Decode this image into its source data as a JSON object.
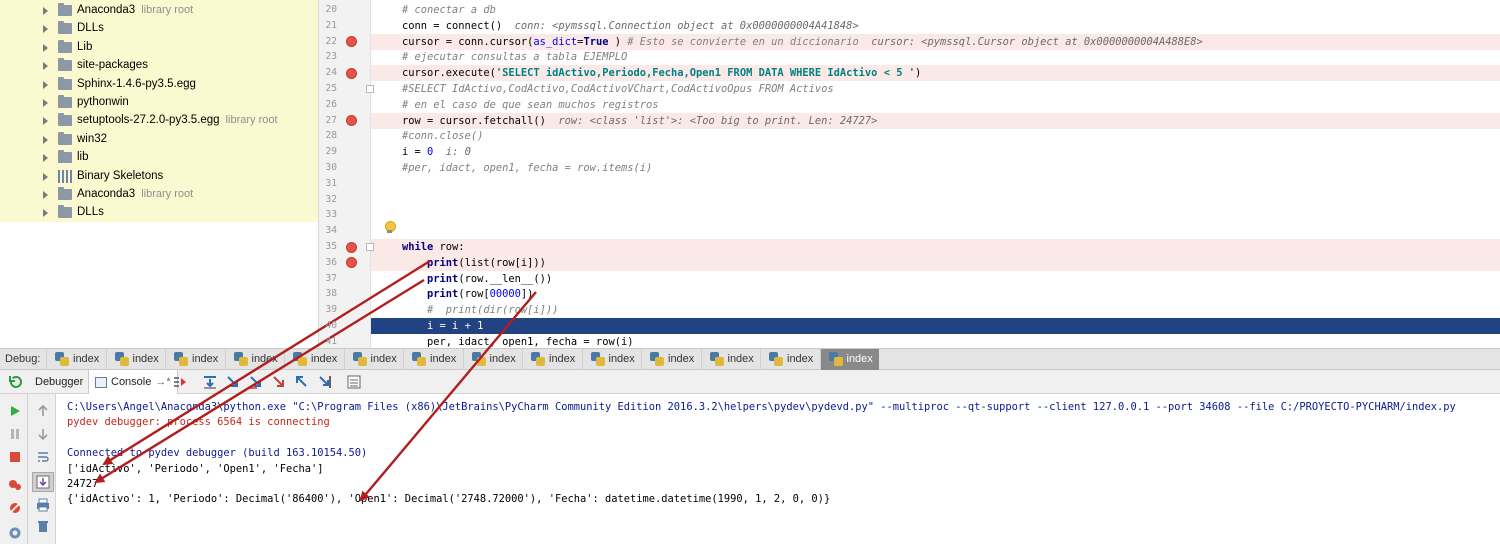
{
  "project_tree": [
    {
      "label": "Anaconda3",
      "hint": "library root",
      "icon": "folder-icon"
    },
    {
      "label": "DLLs",
      "hint": "",
      "icon": "folder-icon"
    },
    {
      "label": "Lib",
      "hint": "",
      "icon": "folder-icon"
    },
    {
      "label": "site-packages",
      "hint": "",
      "icon": "folder-icon"
    },
    {
      "label": "Sphinx-1.4.6-py3.5.egg",
      "hint": "",
      "icon": "folder-icon"
    },
    {
      "label": "pythonwin",
      "hint": "",
      "icon": "folder-icon"
    },
    {
      "label": "setuptools-27.2.0-py3.5.egg",
      "hint": "library root",
      "icon": "folder-icon"
    },
    {
      "label": "win32",
      "hint": "",
      "icon": "folder-icon"
    },
    {
      "label": "lib",
      "hint": "",
      "icon": "folder-icon"
    },
    {
      "label": "Binary Skeletons",
      "hint": "",
      "icon": "library-icon"
    },
    {
      "label": "Anaconda3",
      "hint": "library root",
      "icon": "folder-icon"
    },
    {
      "label": "DLLs",
      "hint": "",
      "icon": "folder-icon"
    }
  ],
  "editor": {
    "lines": [
      {
        "n": "20",
        "bp": false,
        "fold": false,
        "sel": false,
        "indent": "",
        "segs": [
          {
            "c": "cm",
            "t": "# conectar a db"
          }
        ]
      },
      {
        "n": "21",
        "bp": false,
        "fold": false,
        "sel": false,
        "indent": "",
        "segs": [
          {
            "c": "",
            "t": "conn = connect()"
          },
          {
            "c": "hint",
            "t": "  conn: <pymssql.Connection object at 0x0000000004A41848>"
          }
        ]
      },
      {
        "n": "22",
        "bp": true,
        "fold": false,
        "sel": false,
        "indent": "",
        "segs": [
          {
            "c": "",
            "t": "cursor = conn.cursor("
          },
          {
            "c": "num",
            "t": "as_dict"
          },
          {
            "c": "",
            "t": "="
          },
          {
            "c": "kw",
            "t": "True"
          },
          {
            "c": "",
            "t": " ) "
          },
          {
            "c": "cm",
            "t": "# Esto se convierte en un diccionario"
          },
          {
            "c": "hint",
            "t": "  cursor: <pymssql.Cursor object at 0x0000000004A488E8>"
          }
        ]
      },
      {
        "n": "23",
        "bp": false,
        "fold": false,
        "sel": false,
        "indent": "",
        "segs": [
          {
            "c": "cm",
            "t": "# ejecutar consultas a tabla EJEMPLO"
          }
        ]
      },
      {
        "n": "24",
        "bp": true,
        "fold": false,
        "sel": false,
        "indent": "",
        "segs": [
          {
            "c": "",
            "t": "cursor.execute("
          },
          {
            "c": "str",
            "t": "'SELECT idActivo,Periodo,Fecha,Open1 FROM DATA WHERE IdActivo < 5 '"
          },
          {
            "c": "",
            "t": ")"
          }
        ]
      },
      {
        "n": "25",
        "bp": false,
        "fold": true,
        "sel": false,
        "indent": "",
        "segs": [
          {
            "c": "cm",
            "t": "#SELECT IdActivo,CodActivo,CodActivoVChart,CodActivoOpus FROM Activos"
          }
        ]
      },
      {
        "n": "26",
        "bp": false,
        "fold": false,
        "sel": false,
        "indent": "",
        "segs": [
          {
            "c": "cm",
            "t": "# en el caso de que sean muchos registros"
          }
        ]
      },
      {
        "n": "27",
        "bp": true,
        "fold": false,
        "sel": false,
        "indent": "",
        "segs": [
          {
            "c": "",
            "t": "row = cursor.fetchall()"
          },
          {
            "c": "hint",
            "t": "  row: <class 'list'>: <Too big to print. Len: 24727>"
          }
        ]
      },
      {
        "n": "28",
        "bp": false,
        "fold": false,
        "sel": false,
        "indent": "",
        "segs": [
          {
            "c": "cm",
            "t": "#conn.close()"
          }
        ]
      },
      {
        "n": "29",
        "bp": false,
        "fold": false,
        "sel": false,
        "indent": "",
        "segs": [
          {
            "c": "",
            "t": "i = "
          },
          {
            "c": "num",
            "t": "0"
          },
          {
            "c": "hint",
            "t": "  i: 0"
          }
        ]
      },
      {
        "n": "30",
        "bp": false,
        "fold": false,
        "sel": false,
        "indent": "",
        "segs": [
          {
            "c": "cm",
            "t": "#per, idact, open1, fecha = row.items(i)"
          }
        ]
      },
      {
        "n": "31",
        "bp": false,
        "fold": false,
        "sel": false,
        "indent": "",
        "segs": []
      },
      {
        "n": "32",
        "bp": false,
        "fold": false,
        "sel": false,
        "indent": "",
        "segs": []
      },
      {
        "n": "33",
        "bp": false,
        "fold": false,
        "sel": false,
        "indent": "",
        "segs": []
      },
      {
        "n": "34",
        "bp": false,
        "fold": false,
        "sel": false,
        "indent": "",
        "segs": []
      },
      {
        "n": "35",
        "bp": true,
        "fold": true,
        "sel": false,
        "indent": "",
        "segs": [
          {
            "c": "kw",
            "t": "while"
          },
          {
            "c": "",
            "t": " row:"
          }
        ]
      },
      {
        "n": "36",
        "bp": true,
        "fold": false,
        "sel": false,
        "indent": "    ",
        "segs": [
          {
            "c": "kw",
            "t": "print"
          },
          {
            "c": "",
            "t": "(list(row[i]))"
          }
        ]
      },
      {
        "n": "37",
        "bp": false,
        "fold": false,
        "sel": false,
        "indent": "    ",
        "segs": [
          {
            "c": "kw",
            "t": "print"
          },
          {
            "c": "",
            "t": "(row.__len__())"
          }
        ]
      },
      {
        "n": "38",
        "bp": false,
        "fold": false,
        "sel": false,
        "indent": "    ",
        "segs": [
          {
            "c": "kw",
            "t": "print"
          },
          {
            "c": "",
            "t": "(row["
          },
          {
            "c": "num",
            "t": "00000"
          },
          {
            "c": "",
            "t": "])"
          }
        ]
      },
      {
        "n": "39",
        "bp": false,
        "fold": false,
        "sel": false,
        "indent": "    ",
        "segs": [
          {
            "c": "cm",
            "t": "#  print(dir(row[i]))"
          }
        ]
      },
      {
        "n": "40",
        "bp": false,
        "fold": false,
        "sel": true,
        "indent": "    ",
        "segs": [
          {
            "c": "",
            "t": "i = i + 1"
          }
        ]
      },
      {
        "n": "41",
        "bp": false,
        "fold": false,
        "sel": false,
        "indent": "    ",
        "segs": [
          {
            "c": "",
            "t": "per, idact, open1, fecha = row(i)"
          }
        ]
      }
    ]
  },
  "debug_bar": {
    "label": "Debug:",
    "tabs": [
      "index",
      "index",
      "index",
      "index",
      "index",
      "index",
      "index",
      "index",
      "index",
      "index",
      "index",
      "index",
      "index",
      "index"
    ],
    "active_index": 13
  },
  "toolbar": {
    "debugger_tab": "Debugger",
    "console_tab": "Console",
    "console_suffix": "→*"
  },
  "console": [
    {
      "cls": "blue",
      "text": "C:\\Users\\Angel\\Anaconda3\\python.exe \"C:\\Program Files (x86)\\JetBrains\\PyCharm Community Edition 2016.3.2\\helpers\\pydev\\pydevd.py\" --multiproc --qt-support --client 127.0.0.1 --port 34608 --file C:/PROYECTO-PYCHARM/index.py"
    },
    {
      "cls": "red",
      "text": "pydev debugger: process 6564 is connecting"
    },
    {
      "cls": "",
      "text": ""
    },
    {
      "cls": "blue",
      "text": "Connected to pydev debugger (build 163.10154.50)"
    },
    {
      "cls": "",
      "text": "['idActivo', 'Periodo', 'Open1', 'Fecha']"
    },
    {
      "cls": "",
      "text": "24727"
    },
    {
      "cls": "",
      "text": "{'idActivo': 1, 'Periodo': Decimal('86400'), 'Open1': Decimal('2748.72000'), 'Fecha': datetime.datetime(1990, 1, 2, 0, 0)}"
    }
  ],
  "colors": {
    "tree_bg": "#fbf9cf",
    "breakpoint_line": "#fbe9e8",
    "selection": "#214283",
    "arrow": "#b21e1e"
  }
}
